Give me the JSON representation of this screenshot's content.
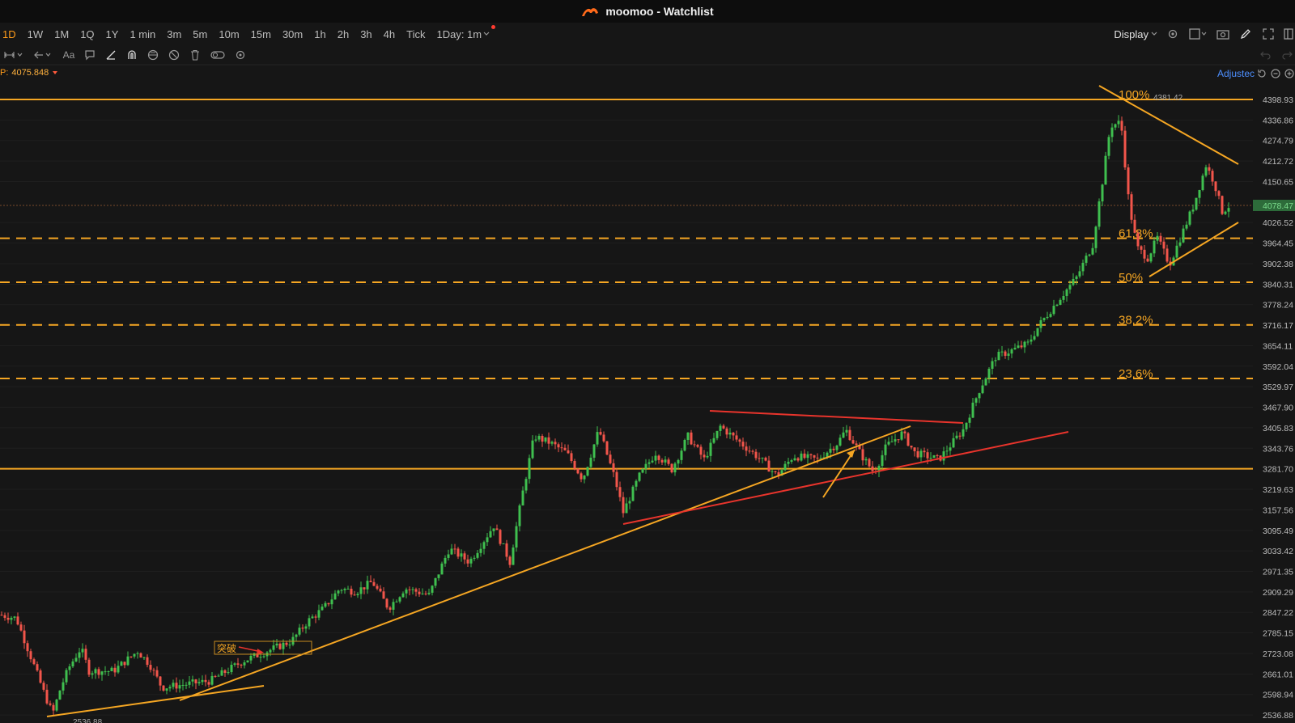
{
  "window": {
    "title": "moomoo - Watchlist"
  },
  "timeframes": [
    {
      "label": "1D",
      "active": true
    },
    {
      "label": "1W"
    },
    {
      "label": "1M"
    },
    {
      "label": "1Q"
    },
    {
      "label": "1Y"
    },
    {
      "label": "1 min"
    },
    {
      "label": "3m"
    },
    {
      "label": "5m"
    },
    {
      "label": "10m"
    },
    {
      "label": "15m"
    },
    {
      "label": "30m"
    },
    {
      "label": "1h"
    },
    {
      "label": "2h"
    },
    {
      "label": "3h"
    },
    {
      "label": "4h"
    },
    {
      "label": "Tick"
    }
  ],
  "interval_dropdown": {
    "label": "1Day: 1m"
  },
  "toolbar_right": {
    "display_label": "Display"
  },
  "indicator": {
    "label": "P:",
    "value": "4075.848"
  },
  "adjust": {
    "label": "Adjustec"
  },
  "price_axis": {
    "ticks": [
      "4398.93",
      "4336.86",
      "4274.79",
      "4212.72",
      "4150.65",
      "4026.52",
      "3964.45",
      "3902.38",
      "3840.31",
      "3778.24",
      "3716.17",
      "3654.11",
      "3592.04",
      "3529.97",
      "3467.90",
      "3405.83",
      "3343.76",
      "3281.70",
      "3219.63",
      "3157.56",
      "3095.49",
      "3033.42",
      "2971.35",
      "2909.29",
      "2847.22",
      "2785.15",
      "2723.08",
      "2661.01",
      "2598.94",
      "2536.88"
    ],
    "last_price": "4078.47"
  },
  "chart_data": {
    "type": "candlestick",
    "y_axis_range": [
      2506,
      4420
    ],
    "high_label": "4381.42",
    "low_label": "2536.88",
    "last_price": 4078.47,
    "horizontal_levels": [
      {
        "price": 4398.93,
        "style": "solid",
        "color": "#f5a623"
      },
      {
        "price": 3281.7,
        "style": "solid",
        "color": "#f5a623"
      }
    ],
    "fib_levels": [
      {
        "label": "100%",
        "price": 4398.93
      },
      {
        "label": "61.8%",
        "price": 3979
      },
      {
        "label": "50%",
        "price": 3846
      },
      {
        "label": "38.2%",
        "price": 3717
      },
      {
        "label": "23.6%",
        "price": 3555
      }
    ],
    "annotation": {
      "text": "突破"
    },
    "colors": {
      "up": "#3fbf4f",
      "down": "#f2554b",
      "level": "#f5a623",
      "trend_red": "#e8342c"
    }
  }
}
